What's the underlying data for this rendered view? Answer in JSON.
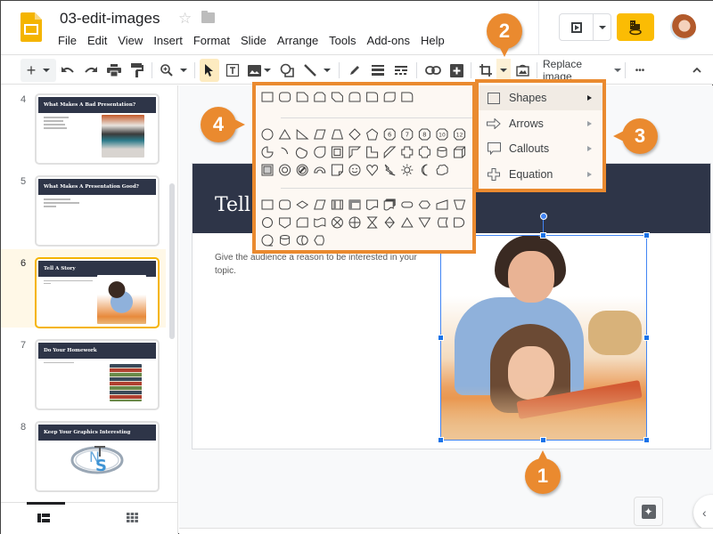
{
  "app": {
    "title": "03-edit-images",
    "menu": [
      "File",
      "Edit",
      "View",
      "Insert",
      "Format",
      "Slide",
      "Arrange",
      "Tools",
      "Add-ons",
      "Help"
    ],
    "accent_color": "#fbbc04"
  },
  "toolbar": {
    "replace_image_label": "Replace image",
    "more_label": "•••"
  },
  "filmstrip": {
    "slides": [
      {
        "number": "4",
        "title": "What Makes A Bad Presentation?",
        "selected": false
      },
      {
        "number": "5",
        "title": "What Makes A Presentation Good?",
        "selected": false
      },
      {
        "number": "6",
        "title": "Tell A Story",
        "selected": true
      },
      {
        "number": "7",
        "title": "Do Your Homework",
        "selected": false
      },
      {
        "number": "8",
        "title": "Keep Your Graphics Interesting",
        "selected": false
      }
    ]
  },
  "slide": {
    "title": "Tell A Story",
    "body": "Give the audience a reason to be interested in your topic."
  },
  "shape_menu": {
    "items": [
      {
        "label": "Shapes",
        "icon": "square-icon",
        "highlighted": true
      },
      {
        "label": "Arrows",
        "icon": "arrow-icon",
        "highlighted": false
      },
      {
        "label": "Callouts",
        "icon": "callout-icon",
        "highlighted": false
      },
      {
        "label": "Equation",
        "icon": "plus-icon",
        "highlighted": false
      }
    ]
  },
  "shapes_panel": {
    "numbered_octagons": [
      "6",
      "7",
      "8",
      "10",
      "12"
    ]
  },
  "callouts": [
    "1",
    "2",
    "3",
    "4"
  ],
  "colors": {
    "callout": "#ea8a2f",
    "slide_header": "#2e3548",
    "selection": "#4285f4"
  }
}
